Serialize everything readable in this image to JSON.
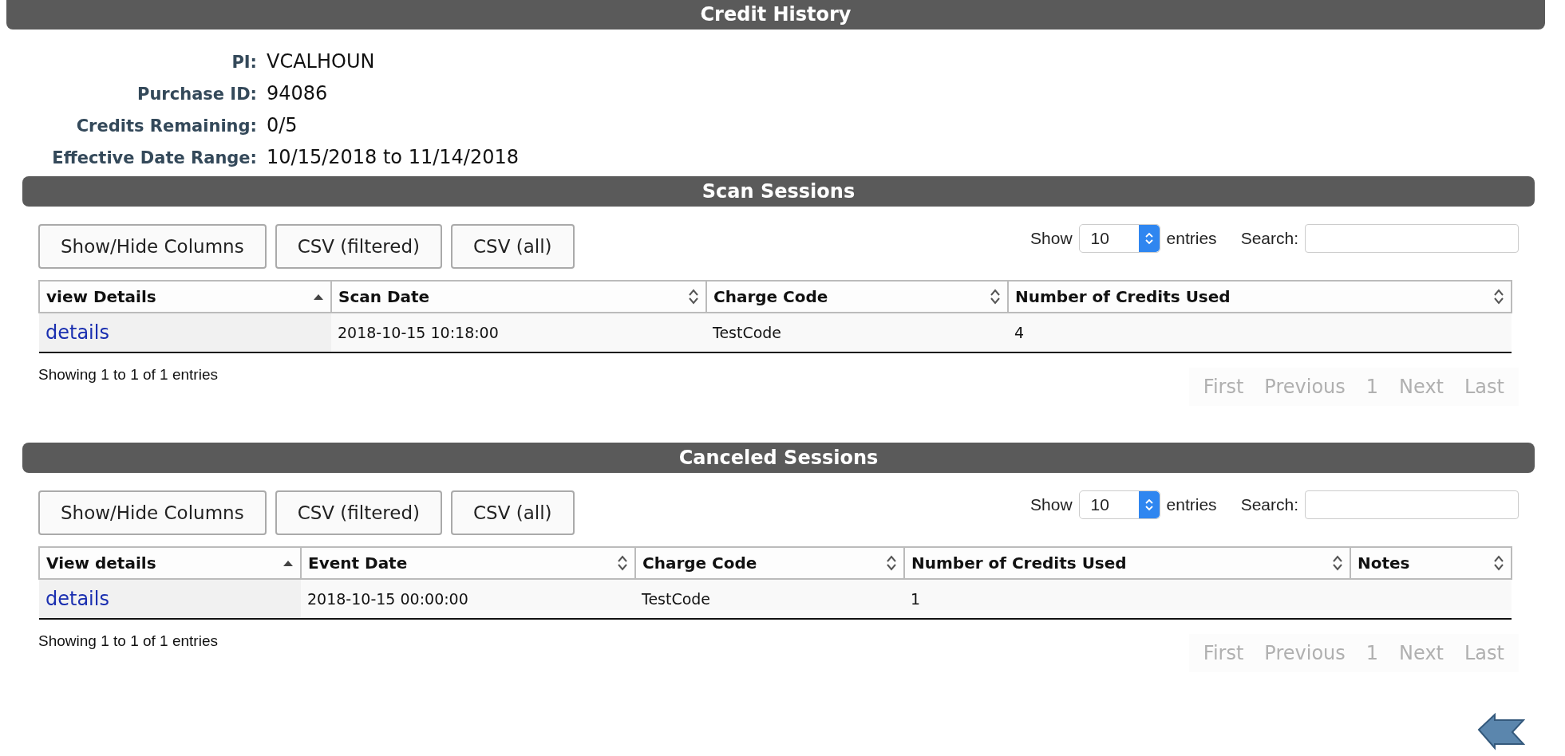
{
  "page_header": {
    "title": "Credit History"
  },
  "summary": [
    {
      "label": "PI:",
      "value": "VCALHOUN"
    },
    {
      "label": "Purchase ID:",
      "value": "94086"
    },
    {
      "label": "Credits Remaining:",
      "value": "0/5"
    },
    {
      "label": "Effective Date Range:",
      "value": "10/15/2018 to 11/14/2018"
    }
  ],
  "sections": [
    {
      "title": "Scan Sessions",
      "buttons": [
        "Show/Hide Columns",
        "CSV (filtered)",
        "CSV (all)"
      ],
      "length_label_before": "Show",
      "length_value": "10",
      "length_label_after": "entries",
      "search_label": "Search:",
      "columns": [
        {
          "label": "view Details",
          "sorted": true
        },
        {
          "label": "Scan Date",
          "sorted": false
        },
        {
          "label": "Charge Code",
          "sorted": false
        },
        {
          "label": "Number of Credits Used",
          "sorted": false
        }
      ],
      "rows": [
        [
          "details",
          "2018-10-15 10:18:00",
          "TestCode",
          "4"
        ]
      ],
      "info": "Showing 1 to 1 of 1 entries",
      "pager": [
        "First",
        "Previous",
        "1",
        "Next",
        "Last"
      ]
    },
    {
      "title": "Canceled Sessions",
      "buttons": [
        "Show/Hide Columns",
        "CSV (filtered)",
        "CSV (all)"
      ],
      "length_label_before": "Show",
      "length_value": "10",
      "length_label_after": "entries",
      "search_label": "Search:",
      "columns": [
        {
          "label": "View details",
          "sorted": true
        },
        {
          "label": "Event Date",
          "sorted": false
        },
        {
          "label": "Charge Code",
          "sorted": false
        },
        {
          "label": "Number of Credits Used",
          "sorted": false
        },
        {
          "label": "Notes",
          "sorted": false
        }
      ],
      "rows": [
        [
          "details",
          "2018-10-15 00:00:00",
          "TestCode",
          "1",
          ""
        ]
      ],
      "info": "Showing 1 to 1 of 1 entries",
      "pager": [
        "First",
        "Previous",
        "1",
        "Next",
        "Last"
      ]
    }
  ]
}
